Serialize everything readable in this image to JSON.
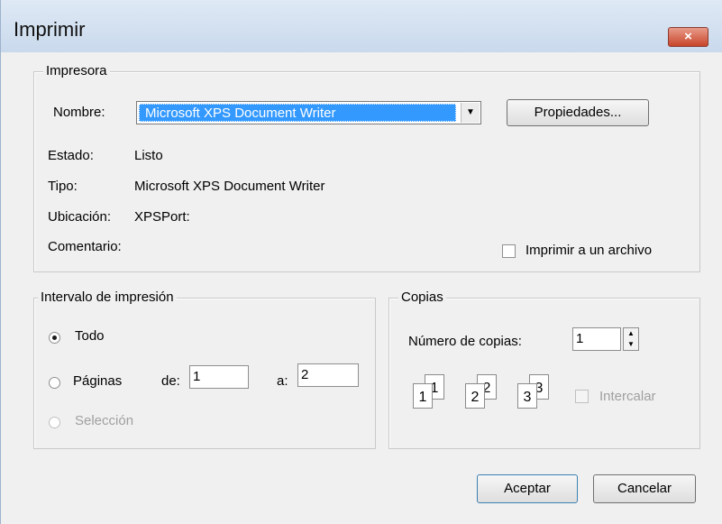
{
  "window": {
    "title": "Imprimir",
    "close_symbol": "×"
  },
  "printer": {
    "legend": "Impresora",
    "name_label": "Nombre:",
    "name_value": "Microsoft XPS Document Writer",
    "properties_button": "Propiedades...",
    "status_label": "Estado:",
    "status_value": "Listo",
    "type_label": "Tipo:",
    "type_value": "Microsoft XPS Document Writer",
    "location_label": "Ubicación:",
    "location_value": "XPSPort:",
    "comment_label": "Comentario:",
    "print_to_file_label": "Imprimir a un archivo",
    "print_to_file_checked": false
  },
  "range": {
    "legend": "Intervalo de impresión",
    "all_label": "Todo",
    "pages_label": "Páginas",
    "from_label": "de:",
    "from_value": "1",
    "to_label": "a:",
    "to_value": "2",
    "selection_label": "Selección",
    "selected": "all"
  },
  "copies": {
    "legend": "Copias",
    "count_label": "Número de copias:",
    "count_value": "1",
    "collate_label": "Intercalar",
    "collate_checked": false,
    "collate_icon_labels": [
      "1",
      "1",
      "2",
      "2",
      "3",
      "3"
    ]
  },
  "buttons": {
    "ok": "Aceptar",
    "cancel": "Cancelar"
  },
  "icons": {
    "dropdown": "▼",
    "spin_up": "▲",
    "spin_down": "▼"
  }
}
